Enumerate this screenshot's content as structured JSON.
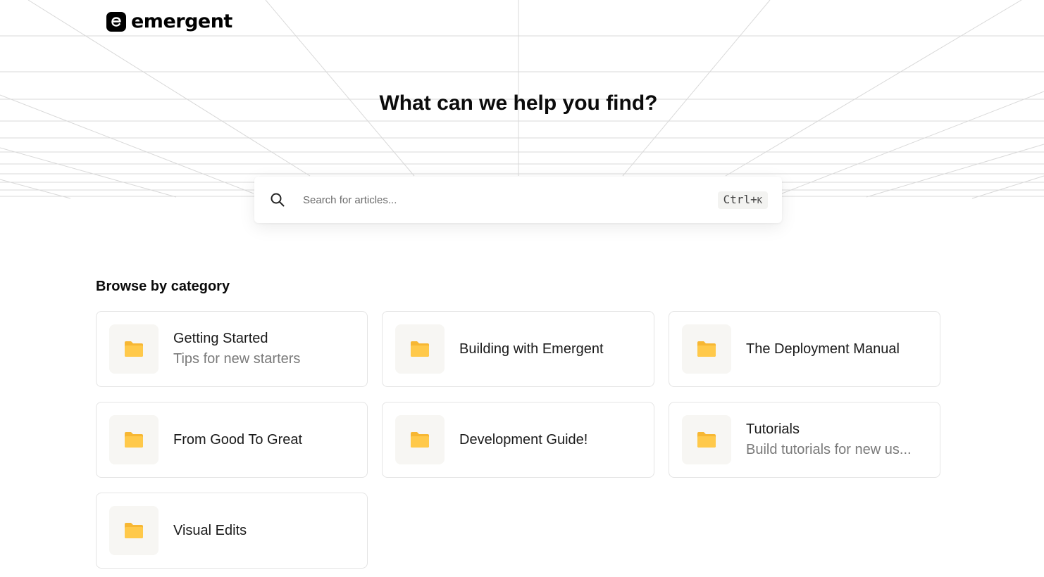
{
  "brand": {
    "name": "emergent",
    "icon": "emergent-logo-icon"
  },
  "hero": {
    "title": "What can we help you find?"
  },
  "search": {
    "placeholder": "Search for articles...",
    "shortcut_main": "Ctrl+",
    "shortcut_key": "K",
    "icon": "search-icon"
  },
  "categories": {
    "title": "Browse by category",
    "items": [
      {
        "title": "Getting Started",
        "description": "Tips for new starters",
        "icon": "folder-icon"
      },
      {
        "title": "Building with Emergent",
        "description": "",
        "icon": "folder-icon"
      },
      {
        "title": "The Deployment Manual",
        "description": "",
        "icon": "folder-icon"
      },
      {
        "title": "From Good To Great",
        "description": "",
        "icon": "folder-icon"
      },
      {
        "title": "Development Guide!",
        "description": "",
        "icon": "folder-icon"
      },
      {
        "title": "Tutorials",
        "description": "Build tutorials for new us...",
        "icon": "folder-icon"
      },
      {
        "title": "Visual Edits",
        "description": "",
        "icon": "folder-icon"
      }
    ]
  },
  "colors": {
    "folder": "#FFC94A",
    "folder_tab": "#F7B733",
    "tile_bg": "#F7F6F3",
    "border": "#E4E4E4",
    "grid_lines": "#D6D6D6"
  }
}
